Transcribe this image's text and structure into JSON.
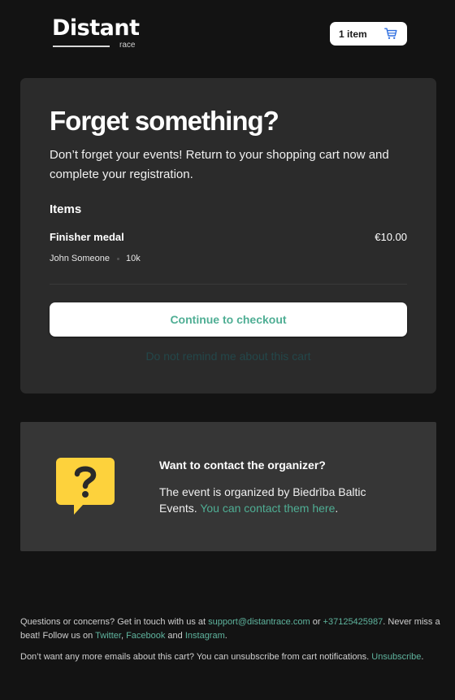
{
  "header": {
    "logo_word": "Distant",
    "logo_sub": "race",
    "cart_count_label": "1 item",
    "cart_icon": "shopping-cart-icon"
  },
  "main_card": {
    "title": "Forget something?",
    "intro": "Don’t forget your events! Return to your shopping cart now and complete your registration.",
    "items_heading": "Items",
    "items": [
      {
        "name": "Finisher medal",
        "price": "€10.00",
        "participant": "John Someone",
        "distance": "10k"
      }
    ],
    "checkout_label": "Continue to checkout",
    "no_remind_label": "Do not remind me about this cart"
  },
  "contact_card": {
    "icon": "question-speech-bubble-icon",
    "heading": "Want to contact the organizer?",
    "text_prefix": "The event is organized by Biedrība Baltic Events. ",
    "link_label": "You can contact them here",
    "text_suffix": "."
  },
  "footer": {
    "p1_a": "Questions or concerns? Get in touch with us at ",
    "email": "support@distantrace.com",
    "p1_b": " or ",
    "phone": "+37125425987",
    "p1_c": ". Never miss a beat! Follow us on ",
    "twitter": "Twitter",
    "p1_d": ", ",
    "facebook": "Facebook",
    "p1_e": " and ",
    "instagram": "Instagram",
    "p1_f": ".",
    "p2_a": "Don’t want any more emails about this cart? You can unsubscribe from cart notifications. ",
    "unsubscribe": "Unsubscribe",
    "p2_b": "."
  },
  "colors": {
    "background": "#131313",
    "card": "#2b2b2b",
    "contact_card": "#363636",
    "accent": "#4fae94",
    "cart_icon": "#2f6fe0",
    "question_icon": "#fdd23c"
  }
}
